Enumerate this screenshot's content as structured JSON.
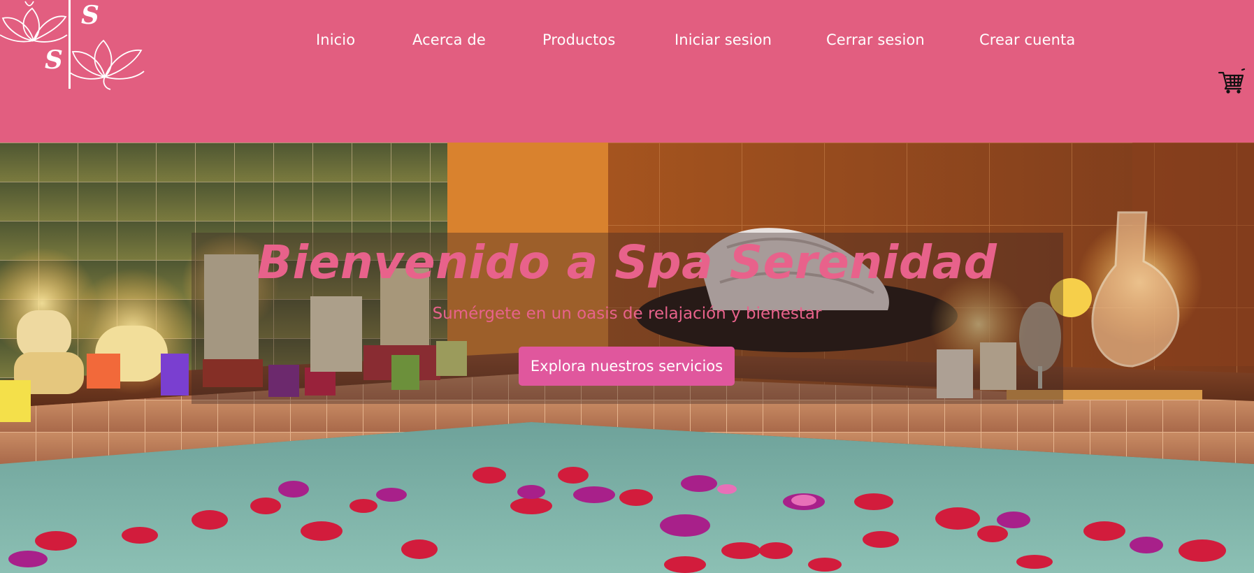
{
  "brand": {
    "logo_letters": [
      "S",
      "S"
    ],
    "color_primary": "#e25e80",
    "color_accent": "#e8628b",
    "color_button": "#e0579d"
  },
  "nav": {
    "items": [
      {
        "label": "Inicio"
      },
      {
        "label": "Acerca de"
      },
      {
        "label": "Productos"
      },
      {
        "label": "Iniciar sesion"
      },
      {
        "label": "Cerrar sesion"
      },
      {
        "label": "Crear cuenta"
      }
    ],
    "cart_icon": "shopping-cart-icon"
  },
  "hero": {
    "title": "Bienvenido a Spa Serenidad",
    "subtitle": "Sumérgete en un oasis de relajación y bienestar",
    "cta_label": "Explora nuestros servicios",
    "background": "spa-bath-with-candles-and-rose-petals"
  }
}
